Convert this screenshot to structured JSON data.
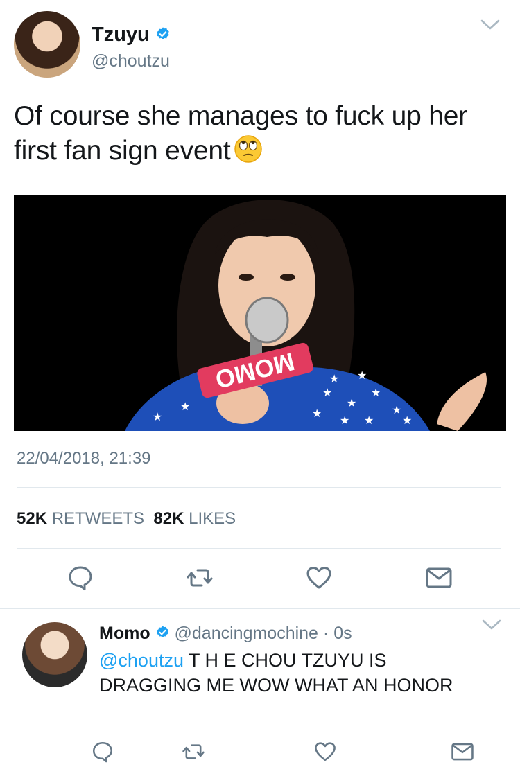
{
  "tweet": {
    "author_name": "Tzuyu",
    "author_handle": "@choutzu",
    "verified_icon": "verified-badge-icon",
    "text": "Of course she manages to fuck up her first fan sign event",
    "emoji": "face-with-rolling-eyes",
    "media_sign_text": "MOMO",
    "timestamp": "22/04/2018, 21:39",
    "stats": {
      "retweets_count": "52K",
      "retweets_label": "RETWEETS",
      "likes_count": "82K",
      "likes_label": "LIKES"
    },
    "actions": [
      "reply-icon",
      "retweet-icon",
      "like-icon",
      "message-icon"
    ]
  },
  "reply": {
    "author_name": "Momo",
    "author_handle": "@dancingmochine",
    "separator": "·",
    "time": "0s",
    "mention": "@choutzu",
    "text_line1": " T H E CHOU TZUYU IS",
    "text_line2": "DRAGGING ME WOW WHAT AN HONOR",
    "actions": [
      "reply-icon",
      "retweet-icon",
      "like-icon",
      "message-icon"
    ]
  },
  "colors": {
    "accent": "#1da1f2",
    "text_primary": "#14171a",
    "text_secondary": "#657786",
    "divider": "#e1e8ed",
    "icon": "#657786"
  }
}
